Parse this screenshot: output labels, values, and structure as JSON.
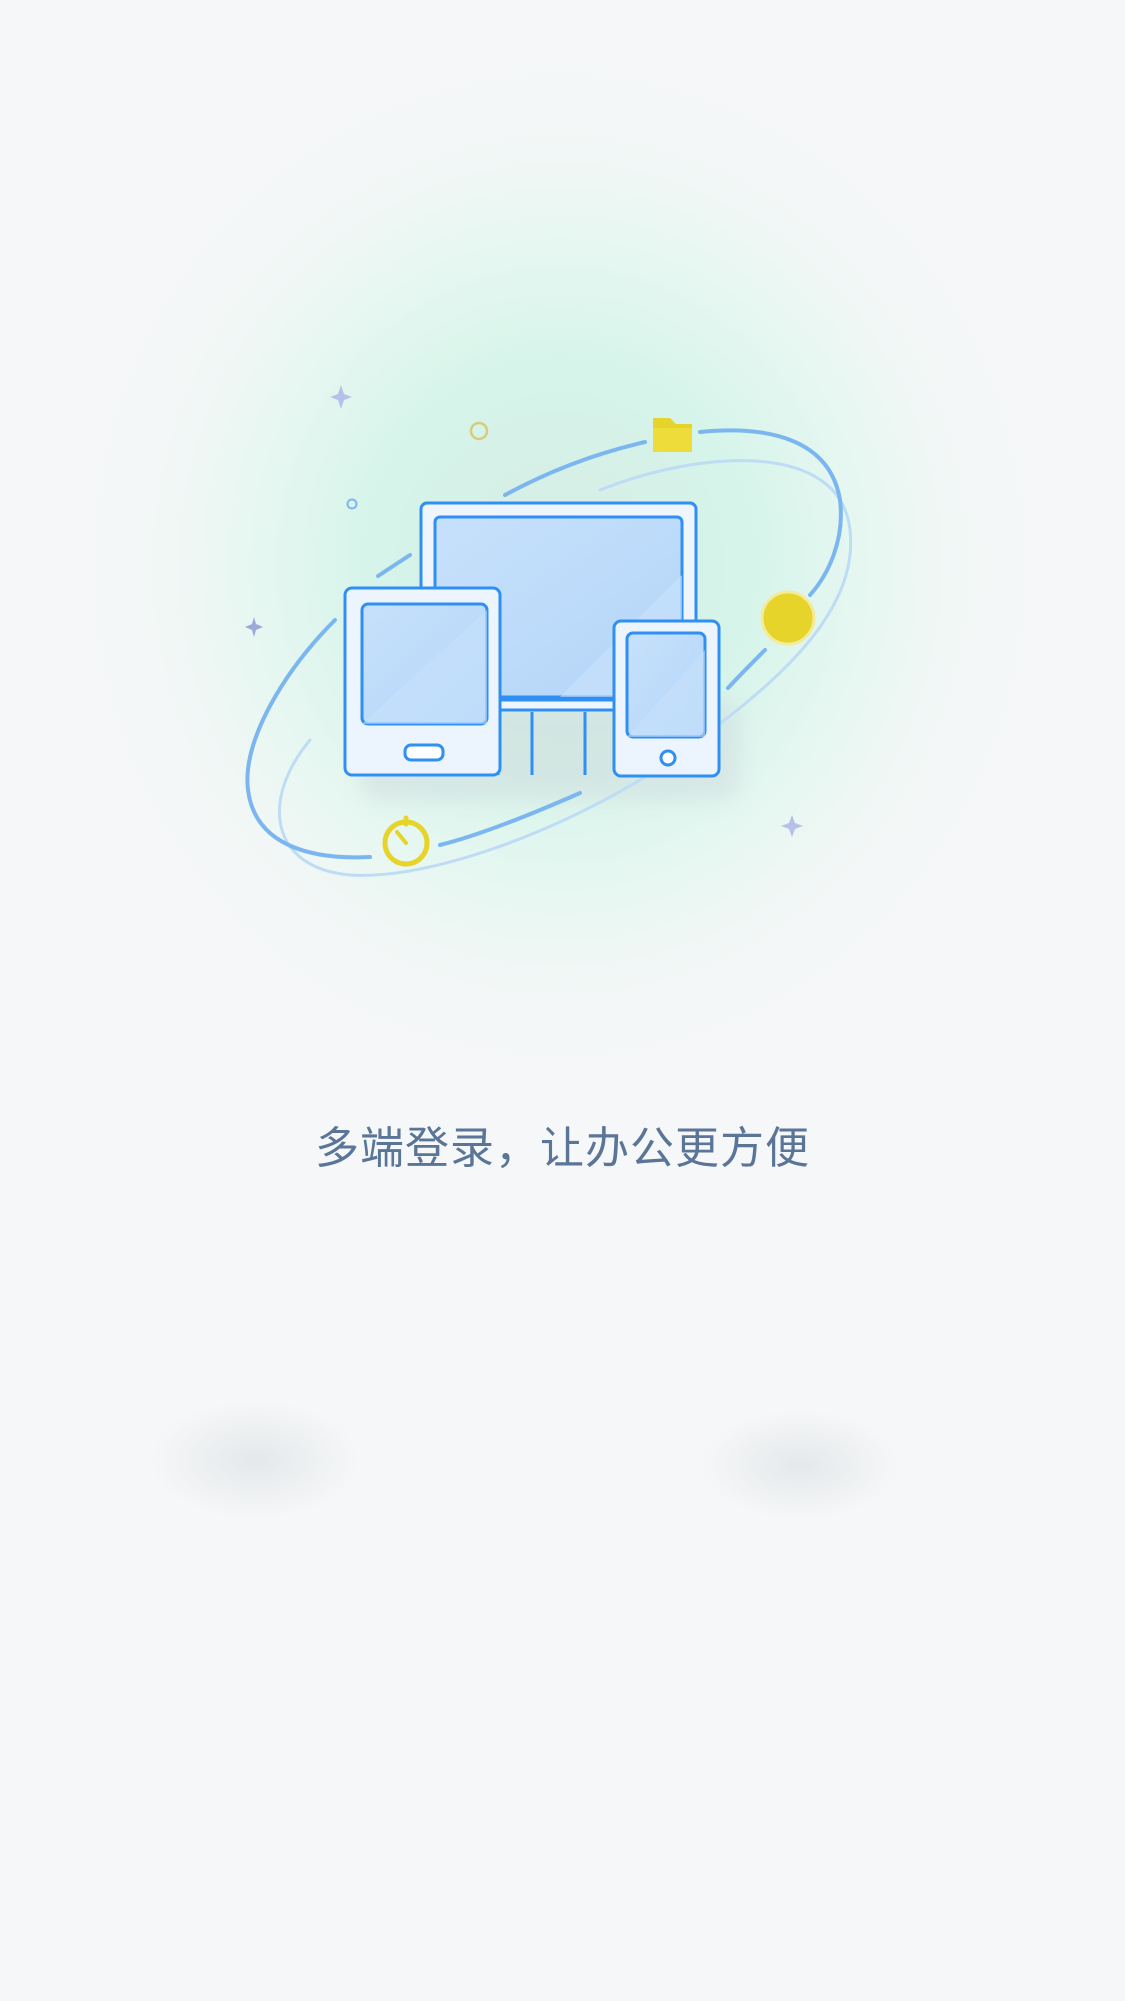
{
  "onboarding": {
    "tagline": "多端登录，让办公更方便",
    "illustration": {
      "icons": [
        "monitor-icon",
        "tablet-icon",
        "phone-icon",
        "folder-icon",
        "timer-icon",
        "coin-icon",
        "sparkle-icon"
      ]
    }
  },
  "colors": {
    "background": "#f5f7f8",
    "device_stroke": "#2f8ff2",
    "device_fill": "#c9e2fb",
    "orbit": "#7bb6f0",
    "accent_yellow": "#e6d42a",
    "glow": "#d2f4e8",
    "tagline": "#5a7598"
  }
}
